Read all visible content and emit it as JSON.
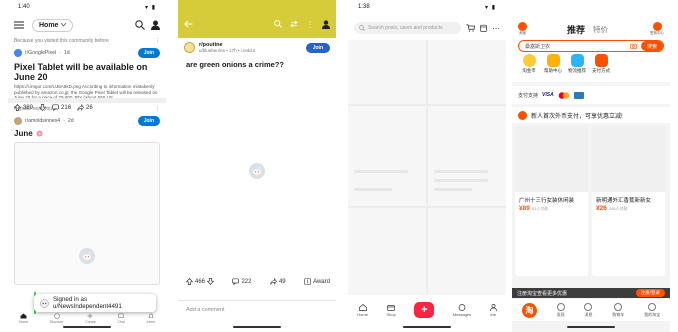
{
  "phone1": {
    "status_time": "1:40",
    "status_icons": "▾ ▮",
    "home_label": "Home",
    "reason": "Because you visited this community before",
    "post1": {
      "subreddit": "r/GooglePixel",
      "age": "1d",
      "join": "Join",
      "title": "Pixel Tablet will be available on June 20",
      "body": "https://i.imgur.com/UJ6A6kD.png According to information mistakenly published by amazon.co.jp, the Google Pixel Tablet will be released on June 20 for a price of 79,800 JPY (about 550 US...",
      "upvotes": "389",
      "comments": "216",
      "shares": "26"
    },
    "popular": "Popular near you",
    "post2": {
      "subreddit": "r/amoldsinnes4",
      "age": "2d",
      "join": "Join",
      "title": "June"
    },
    "toast": "Signed in as u/NewsIndependent4491",
    "tabs": [
      "Home",
      "Discover",
      "Create",
      "Chat",
      "Inbox"
    ]
  },
  "phone2": {
    "subreddit": "r/poutine",
    "meta": "u/blueberries • 17h • i.redd.it",
    "join": "Join",
    "title": "are green onions a crime??",
    "upvotes": "466",
    "comments": "222",
    "shares": "49",
    "award": "Award",
    "comment_placeholder": "Add a comment"
  },
  "phone3": {
    "status_time": "1:38",
    "search_placeholder": "Search posts, users and products",
    "tabs": [
      "Home",
      "Shop",
      "",
      "Messages",
      "Me"
    ]
  },
  "phone4": {
    "corner_left": "淘宝",
    "tab_main": "推荐",
    "tab_secondary": "特价",
    "corner_right": "签到中心",
    "search_placeholder": "桑塞斯卫衣",
    "search_button": "搜索",
    "categories": [
      "淘金币",
      "帮助中心",
      "物流推荐",
      "支付方式"
    ],
    "pay_text": "支付支持",
    "pay_visa": "VISA",
    "banner": "新人首次外币支付，可享优惠立减!",
    "card1": {
      "name": "广州十三行女装休闲装",
      "price": "¥89",
      "sold": "31人付款"
    },
    "card2": {
      "name": "新明通外汇香蕉新新女",
      "price": "¥26",
      "sold": "108人付款"
    },
    "promo": "注册淘宝查看更多优惠",
    "promo_button": "注册/登录",
    "tabs": [
      "首页",
      "发现",
      "消息",
      "购物车",
      "我的淘宝"
    ],
    "taobao_glyph": "淘"
  }
}
